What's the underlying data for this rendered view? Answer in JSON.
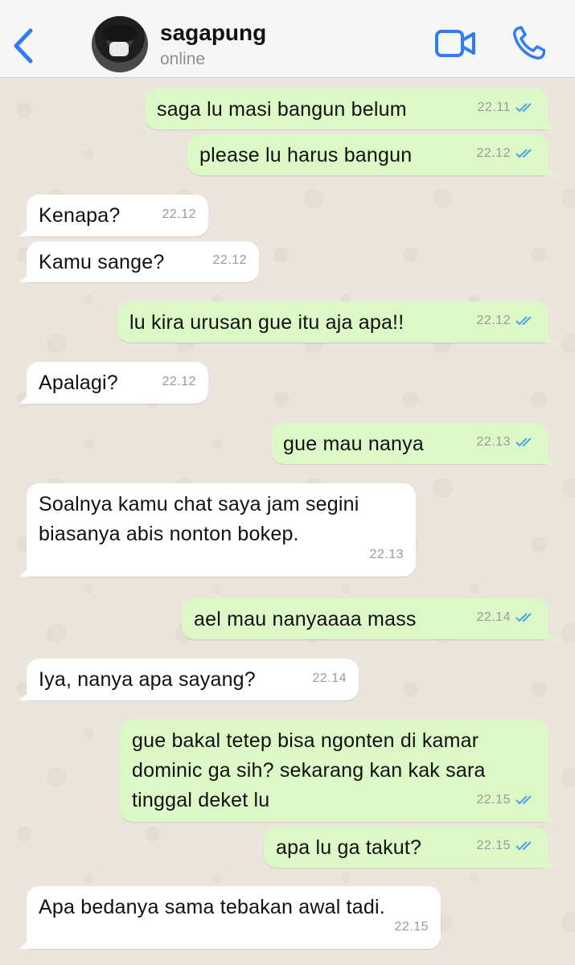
{
  "header": {
    "contact_name": "sagapung",
    "status": "online",
    "back_icon": "chevron-left-icon",
    "video_icon": "video-call-icon",
    "call_icon": "phone-icon",
    "accent_color": "#2f7cf6"
  },
  "messages": [
    {
      "dir": "out",
      "text": "saga lu masi bangun belum",
      "time": "22.11",
      "read": true
    },
    {
      "dir": "out",
      "text": "please lu harus bangun",
      "time": "22.12",
      "read": true
    },
    {
      "dir": "in",
      "text": "Kenapa?",
      "time": "22.12"
    },
    {
      "dir": "in",
      "text": "Kamu sange?",
      "time": "22.12"
    },
    {
      "dir": "out",
      "text": "lu kira urusan gue itu aja apa!!",
      "time": "22.12",
      "read": true
    },
    {
      "dir": "in",
      "text": "Apalagi?",
      "time": "22.12"
    },
    {
      "dir": "out",
      "text": "gue mau nanya",
      "time": "22.13",
      "read": true
    },
    {
      "dir": "in",
      "text": "Soalnya kamu chat saya jam segini\nbiasanya abis nonton bokep.",
      "time": "22.13"
    },
    {
      "dir": "out",
      "text": "ael mau nanyaaaa mass",
      "time": "22.14",
      "read": true
    },
    {
      "dir": "in",
      "text": "Iya, nanya apa sayang?",
      "time": "22.14"
    },
    {
      "dir": "out",
      "text": "gue bakal tetep bisa ngonten di kamar\ndominic ga sih? sekarang kan kak sara\ntinggal deket lu",
      "time": "22.15",
      "read": true
    },
    {
      "dir": "out",
      "text": "apa lu ga takut?",
      "time": "22.15",
      "read": true
    },
    {
      "dir": "in",
      "text": "Apa bedanya sama tebakan awal tadi.",
      "time": "22.15"
    }
  ]
}
